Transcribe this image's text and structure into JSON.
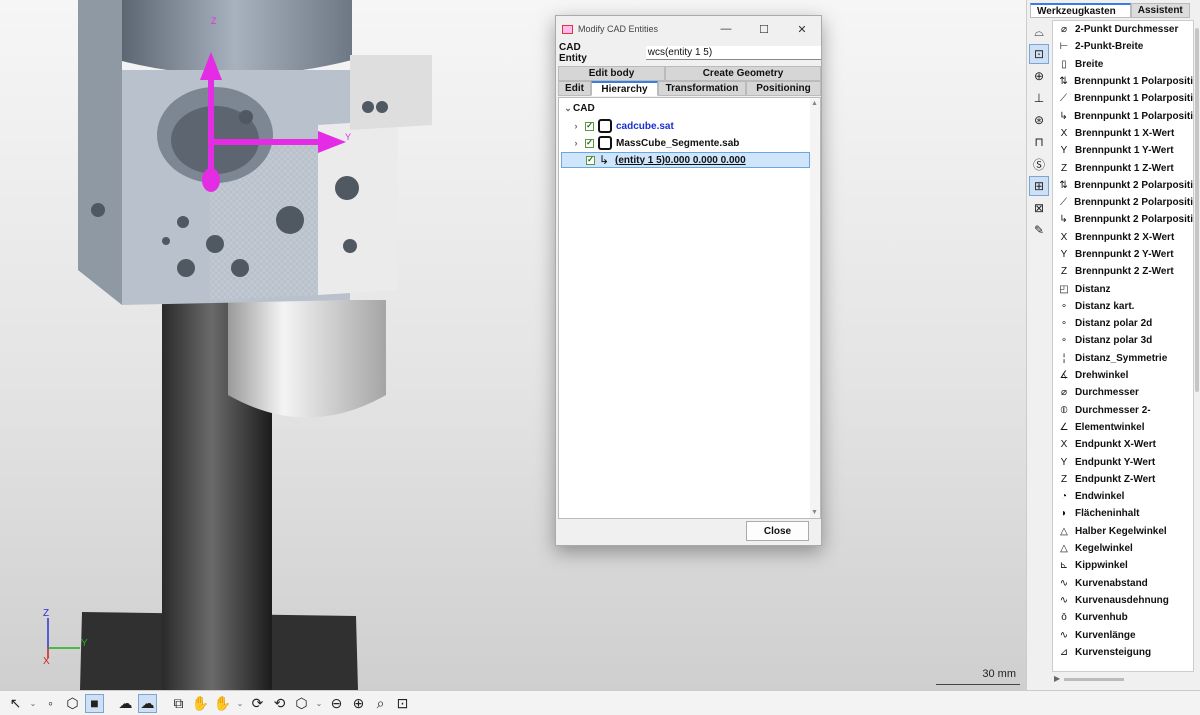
{
  "viewport": {
    "scale_label": "30 mm",
    "triad": {
      "z": "Z",
      "y": "Y",
      "x": "X"
    },
    "manipulator": {
      "z": "Z",
      "y": "Y"
    }
  },
  "dialog": {
    "title": "Modify CAD Entities",
    "window_buttons": {
      "minimize": "—",
      "maximize": "☐",
      "close": "✕"
    },
    "cad_entity_label": "CAD Entity",
    "cad_entity_value": "wcs(entity 1 5)",
    "tabs_row1": [
      "Edit body",
      "Create Geometry"
    ],
    "tabs_row2": [
      "Edit",
      "Hierarchy",
      "Transformation",
      "Positioning"
    ],
    "active_tab": "Hierarchy",
    "tree": {
      "root": "CAD",
      "items": [
        {
          "label": "cadcube.sat",
          "checked": true
        },
        {
          "label": "MassCube_Segmente.sab",
          "checked": true
        },
        {
          "label": "(entity 1 5)0.000 0.000 0.000",
          "checked": true,
          "selected": true
        }
      ]
    },
    "close_label": "Close"
  },
  "panel": {
    "tabs": [
      "Werkzeugkasten",
      "Assistent"
    ],
    "active_tab": "Werkzeugkasten",
    "side_icons": [
      "form-icon",
      "position-icon",
      "profile-icon",
      "datum-icon",
      "curve-icon",
      "probe-icon",
      "special-icon",
      "toolbox-icon",
      "report-icon",
      "pen-icon"
    ],
    "items": [
      {
        "label": "2-Punkt Durchmesser",
        "icon": "⌀"
      },
      {
        "label": "2-Punkt-Breite",
        "icon": "⊢"
      },
      {
        "label": "Breite",
        "icon": "▯"
      },
      {
        "label": "Brennpunkt 1 Polarpositi",
        "icon": "⇅"
      },
      {
        "label": "Brennpunkt 1 Polarpositi",
        "icon": "⟋"
      },
      {
        "label": "Brennpunkt 1 Polarpositi",
        "icon": "↳"
      },
      {
        "label": "Brennpunkt 1 X-Wert",
        "icon": "X"
      },
      {
        "label": "Brennpunkt 1 Y-Wert",
        "icon": "Y"
      },
      {
        "label": "Brennpunkt 1 Z-Wert",
        "icon": "Z"
      },
      {
        "label": "Brennpunkt 2 Polarpositi",
        "icon": "⇅"
      },
      {
        "label": "Brennpunkt 2 Polarpositi",
        "icon": "⟋"
      },
      {
        "label": "Brennpunkt 2 Polarpositi",
        "icon": "↳"
      },
      {
        "label": "Brennpunkt 2 X-Wert",
        "icon": "X"
      },
      {
        "label": "Brennpunkt 2 Y-Wert",
        "icon": "Y"
      },
      {
        "label": "Brennpunkt 2 Z-Wert",
        "icon": "Z"
      },
      {
        "label": "Distanz",
        "icon": "◰"
      },
      {
        "label": "Distanz kart.",
        "icon": "∘"
      },
      {
        "label": "Distanz polar 2d",
        "icon": "∘"
      },
      {
        "label": "Distanz polar 3d",
        "icon": "∘"
      },
      {
        "label": "Distanz_Symmetrie",
        "icon": "¦"
      },
      {
        "label": "Drehwinkel",
        "icon": "∡"
      },
      {
        "label": "Durchmesser",
        "icon": "⌀"
      },
      {
        "label": "Durchmesser 2-",
        "icon": "⦶"
      },
      {
        "label": "Elementwinkel",
        "icon": "∠"
      },
      {
        "label": "Endpunkt X-Wert",
        "icon": "X"
      },
      {
        "label": "Endpunkt Y-Wert",
        "icon": "Y"
      },
      {
        "label": "Endpunkt Z-Wert",
        "icon": "Z"
      },
      {
        "label": "Endwinkel",
        "icon": "◔"
      },
      {
        "label": "Flächeninhalt",
        "icon": "◗"
      },
      {
        "label": "Halber Kegelwinkel",
        "icon": "△"
      },
      {
        "label": "Kegelwinkel",
        "icon": "△"
      },
      {
        "label": "Kippwinkel",
        "icon": "⊾"
      },
      {
        "label": "Kurvenabstand",
        "icon": "∿"
      },
      {
        "label": "Kurvenausdehnung",
        "icon": "∿"
      },
      {
        "label": "Kurvenhub",
        "icon": "ō"
      },
      {
        "label": "Kurvenlänge",
        "icon": "∿"
      },
      {
        "label": "Kurvensteigung",
        "icon": "⊿"
      }
    ]
  },
  "toolbar": {
    "buttons": [
      {
        "name": "select-icon",
        "glyph": "↖"
      },
      {
        "name": "select-dropdown-icon",
        "glyph": "⌄",
        "small": true
      },
      {
        "name": "dot-icon",
        "glyph": "◦"
      },
      {
        "name": "wireframe-icon",
        "glyph": "⬡"
      },
      {
        "name": "solid-icon",
        "glyph": "■",
        "active": true
      },
      {
        "name": "sep",
        "glyph": ""
      },
      {
        "name": "transparency-icon",
        "glyph": "☁"
      },
      {
        "name": "transparency-active-icon",
        "glyph": "☁",
        "active": true
      },
      {
        "name": "sep",
        "glyph": ""
      },
      {
        "name": "zoom-window-icon",
        "glyph": "⧉"
      },
      {
        "name": "pan-icon",
        "glyph": "✋"
      },
      {
        "name": "pan-xyz-icon",
        "glyph": "✋"
      },
      {
        "name": "pan-dropdown-icon",
        "glyph": "⌄",
        "small": true
      },
      {
        "name": "rotate-cw-icon",
        "glyph": "⟳"
      },
      {
        "name": "rotate-ccw-icon",
        "glyph": "⟲"
      },
      {
        "name": "view-cube-icon",
        "glyph": "⬡"
      },
      {
        "name": "view-dropdown-icon",
        "glyph": "⌄",
        "small": true
      },
      {
        "name": "zoom-out-icon",
        "glyph": "⊖"
      },
      {
        "name": "zoom-in-icon",
        "glyph": "⊕"
      },
      {
        "name": "zoom-icon",
        "glyph": "⌕"
      },
      {
        "name": "fit-view-icon",
        "glyph": "⊡"
      }
    ]
  }
}
